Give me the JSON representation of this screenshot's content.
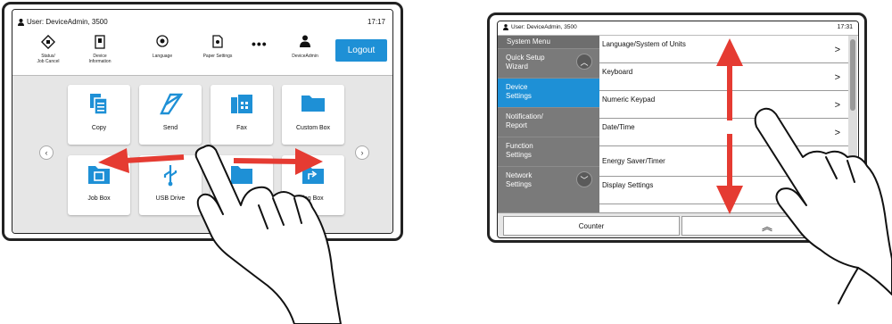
{
  "left_panel": {
    "status_bar": {
      "user_label": "User: DeviceAdmin, 3500",
      "time": "17:17"
    },
    "toolbar": {
      "status": "Status/\nJob Cancel",
      "device_info": "Device\nInformation",
      "language": "Language",
      "paper_settings": "Paper Settings",
      "more": "•••",
      "user": "DeviceAdmin",
      "logout": "Logout"
    },
    "tiles": [
      {
        "label": "Copy",
        "icon": "copy-icon"
      },
      {
        "label": "Send",
        "icon": "send-icon"
      },
      {
        "label": "Fax",
        "icon": "fax-icon"
      },
      {
        "label": "Custom Box",
        "icon": "custom-box-icon"
      },
      {
        "label": "Job Box",
        "icon": "job-box-icon"
      },
      {
        "label": "USB Drive",
        "icon": "usb-drive-icon"
      },
      {
        "label": "",
        "icon": "box-icon"
      },
      {
        "label": "ing Box",
        "icon": "sending-box-icon"
      }
    ],
    "nav": {
      "prev": "‹",
      "next": "›"
    }
  },
  "right_panel": {
    "status_bar": {
      "user_label": "User: DeviceAdmin, 3500",
      "time": "17:31"
    },
    "sidebar": {
      "header": "System Menu",
      "items": [
        {
          "label": "Quick Setup\nWizard"
        },
        {
          "label": "Device\nSettings"
        },
        {
          "label": "Notification/\nReport"
        },
        {
          "label": "Function\nSettings"
        },
        {
          "label": "Network\nSettings"
        }
      ],
      "scroll_up": "︿",
      "scroll_down": "﹀"
    },
    "list": [
      {
        "label": "Language/System of Units"
      },
      {
        "label": "Keyboard"
      },
      {
        "label": "Numeric Keypad"
      },
      {
        "label": "Date/Time"
      },
      {
        "label": "Energy Saver/Timer"
      },
      {
        "label": "Display Settings"
      }
    ],
    "footer": {
      "counter": "Counter",
      "collapse": "︽"
    }
  },
  "colors": {
    "accent": "#1e90d6",
    "arrow": "#e53b32",
    "sidebar": "#7a7a7a"
  }
}
